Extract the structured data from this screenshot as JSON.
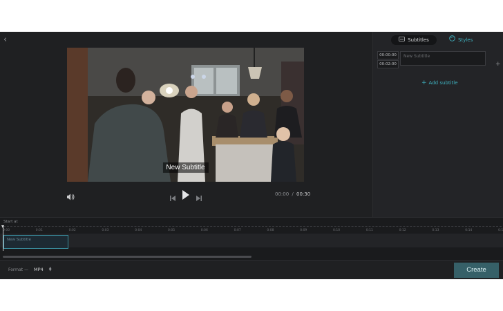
{
  "editor": {
    "overlay_subtitle": "New Subtitle",
    "time_current": "00:00",
    "time_separator": "/",
    "time_total": "00:30"
  },
  "panel": {
    "tabs": [
      {
        "label": "Subtitles",
        "icon": "subtitles-icon",
        "active": true
      },
      {
        "label": "Styles",
        "icon": "palette-icon",
        "active": false
      }
    ],
    "entry": {
      "start": "00:00:00",
      "end": "00:02:00",
      "placeholder": "New Subtitle"
    },
    "add_label": "Add subtitle"
  },
  "timeline": {
    "start_label": "Start at",
    "ticks": [
      "0:00",
      "0:01",
      "0:02",
      "0:03",
      "0:04",
      "0:05",
      "0:06",
      "0:07",
      "0:08",
      "0:09",
      "0:10",
      "0:11",
      "0:12",
      "0:13",
      "0:14",
      "0:15"
    ],
    "clip_label": "New Subtitle"
  },
  "bottom": {
    "format_label": "Format —",
    "format_value": "MP4",
    "create_label": "Create"
  },
  "colors": {
    "accent": "#3fb2c0",
    "create_bg": "#366068"
  }
}
